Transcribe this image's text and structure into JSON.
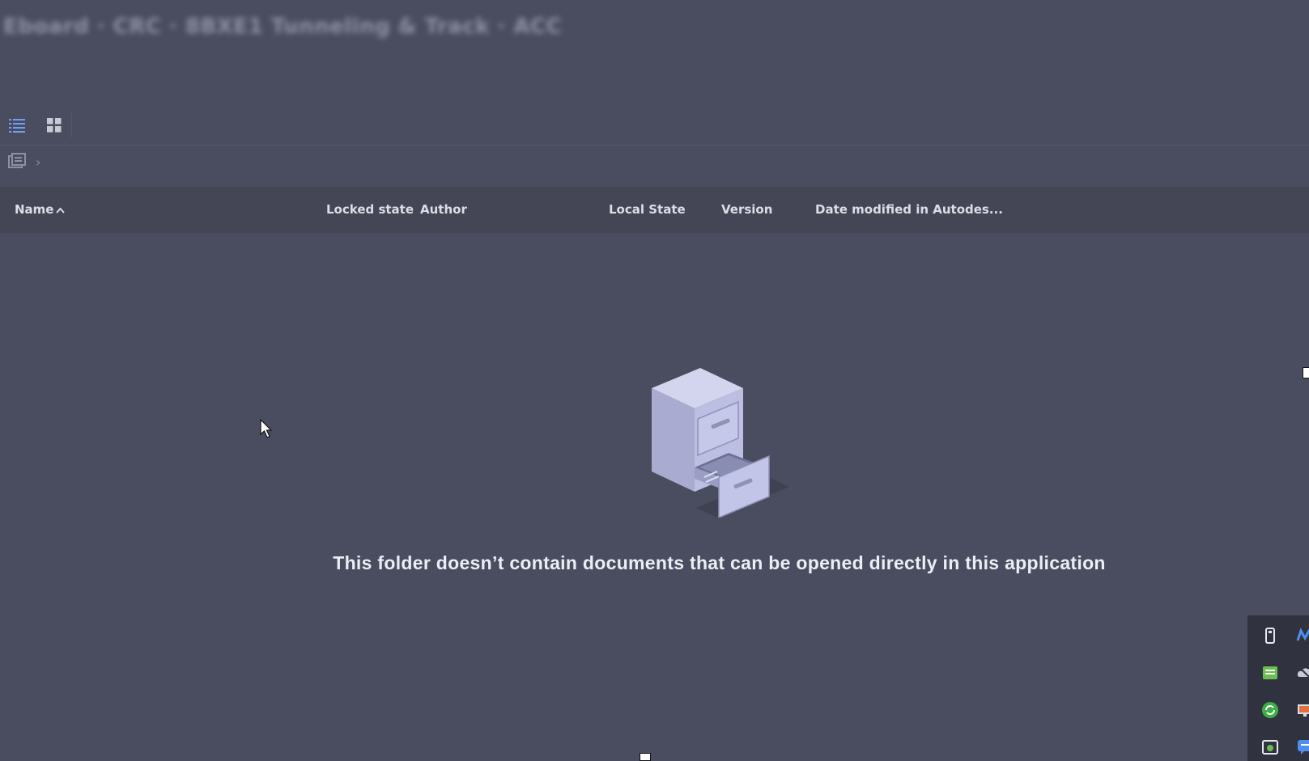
{
  "window": {
    "title": "Eboard · CRC · 8BXE1 Tunneling & Track · ACC"
  },
  "toolbar": {
    "list_view_icon": "list-view-icon",
    "grid_view_icon": "grid-view-icon",
    "active_view": "list"
  },
  "breadcrumb": {
    "root_icon": "project-folder-icon",
    "separator": "›"
  },
  "columns": {
    "name": "Name",
    "locked_state": "Locked state",
    "author": "Author",
    "local_state": "Local State",
    "version": "Version",
    "date_modified": "Date modified in Autodes...",
    "sort_column": "name",
    "sort_direction": "ascending"
  },
  "empty_state": {
    "icon": "file-cabinet-icon",
    "message": "This folder doesn’t contain documents that can be opened directly in this application"
  },
  "tray": {
    "icons": [
      "usb-icon",
      "meet-icon",
      "notes-icon",
      "cloud-off-icon",
      "sync-icon",
      "display-icon",
      "camera-icon",
      "chat-icon"
    ]
  },
  "colors": {
    "background": "#4a4d5f",
    "header_background": "#444656",
    "accent": "#6f9ef5"
  }
}
